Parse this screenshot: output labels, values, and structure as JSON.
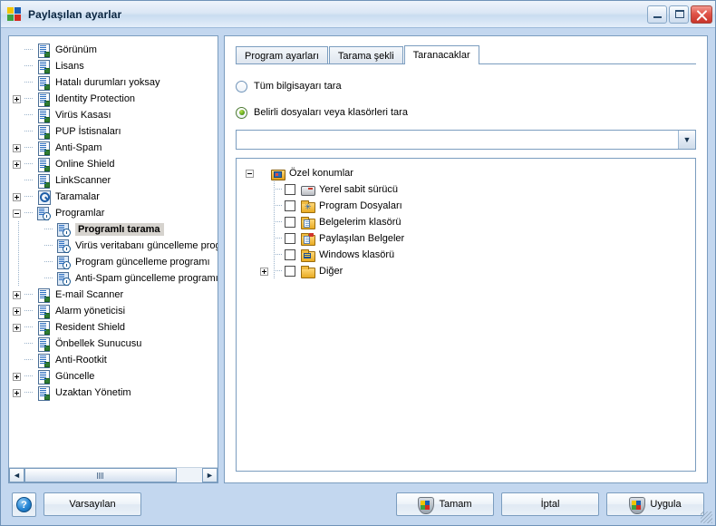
{
  "window": {
    "title": "Paylaşılan ayarlar",
    "icon": "avg-logo-icon",
    "minimize_label": "",
    "maximize_label": "",
    "close_label": ""
  },
  "sidebar": {
    "items": [
      {
        "label": "Görünüm",
        "icon": "settings-doc-icon",
        "expander": "none",
        "depth": 1,
        "selected": false
      },
      {
        "label": "Lisans",
        "icon": "settings-doc-icon",
        "expander": "none",
        "depth": 1,
        "selected": false
      },
      {
        "label": "Hatalı durumları yoksay",
        "icon": "settings-doc-icon",
        "expander": "none",
        "depth": 1,
        "selected": false
      },
      {
        "label": "Identity Protection",
        "icon": "settings-doc-icon",
        "expander": "plus",
        "depth": 1,
        "selected": false
      },
      {
        "label": "Virüs Kasası",
        "icon": "settings-doc-icon",
        "expander": "none",
        "depth": 1,
        "selected": false
      },
      {
        "label": "PUP İstisnaları",
        "icon": "settings-doc-icon",
        "expander": "none",
        "depth": 1,
        "selected": false
      },
      {
        "label": "Anti-Spam",
        "icon": "settings-doc-icon",
        "expander": "plus",
        "depth": 1,
        "selected": false
      },
      {
        "label": "Online Shield",
        "icon": "settings-doc-icon",
        "expander": "plus",
        "depth": 1,
        "selected": false
      },
      {
        "label": "LinkScanner",
        "icon": "settings-doc-icon",
        "expander": "none",
        "depth": 1,
        "selected": false
      },
      {
        "label": "Taramalar",
        "icon": "scan-magnifier-icon",
        "expander": "plus",
        "depth": 1,
        "selected": false
      },
      {
        "label": "Programlar",
        "icon": "schedule-clock-icon",
        "expander": "minus",
        "depth": 1,
        "selected": false
      },
      {
        "label": "Programlı tarama",
        "icon": "schedule-clock-icon",
        "expander": "none",
        "depth": 2,
        "selected": true
      },
      {
        "label": "Virüs veritabanı güncelleme programı",
        "icon": "schedule-clock-icon",
        "expander": "none",
        "depth": 2,
        "selected": false
      },
      {
        "label": "Program güncelleme programı",
        "icon": "schedule-clock-icon",
        "expander": "none",
        "depth": 2,
        "selected": false
      },
      {
        "label": "Anti-Spam güncelleme programı",
        "icon": "schedule-clock-icon",
        "expander": "none",
        "depth": 2,
        "selected": false
      },
      {
        "label": "E-mail Scanner",
        "icon": "settings-doc-icon",
        "expander": "plus",
        "depth": 1,
        "selected": false
      },
      {
        "label": "Alarm yöneticisi",
        "icon": "settings-doc-icon",
        "expander": "plus",
        "depth": 1,
        "selected": false
      },
      {
        "label": "Resident Shield",
        "icon": "settings-doc-icon",
        "expander": "plus",
        "depth": 1,
        "selected": false
      },
      {
        "label": "Önbellek Sunucusu",
        "icon": "settings-doc-icon",
        "expander": "none",
        "depth": 1,
        "selected": false
      },
      {
        "label": "Anti-Rootkit",
        "icon": "settings-doc-icon",
        "expander": "none",
        "depth": 1,
        "selected": false
      },
      {
        "label": "Güncelle",
        "icon": "settings-doc-icon",
        "expander": "plus",
        "depth": 1,
        "selected": false
      },
      {
        "label": "Uzaktan Yönetim",
        "icon": "settings-doc-icon",
        "expander": "plus",
        "depth": 1,
        "selected": false
      }
    ],
    "scroll_left_label": "◄",
    "scroll_right_label": "►"
  },
  "main": {
    "tabs": [
      {
        "label": "Program ayarları",
        "active": false
      },
      {
        "label": "Tarama şekli",
        "active": false
      },
      {
        "label": "Taranacaklar",
        "active": true
      }
    ],
    "radios": [
      {
        "label": "Tüm bilgisayarı tara",
        "checked": false
      },
      {
        "label": "Belirli dosyaları veya klasörleri tara",
        "checked": true
      }
    ],
    "combo": {
      "value": "",
      "arrow": "▼"
    },
    "filetree": [
      {
        "label": "Özel konumlar",
        "icon": "special-locations-folder-icon",
        "expander": "minus",
        "checkbox": false,
        "has_checkbox": false,
        "depth": 0
      },
      {
        "label": "Yerel sabit sürücü",
        "icon": "hard-drive-icon",
        "expander": "none",
        "checkbox": false,
        "has_checkbox": true,
        "depth": 1
      },
      {
        "label": "Program Dosyaları",
        "icon": "program-files-folder-icon",
        "expander": "none",
        "checkbox": false,
        "has_checkbox": true,
        "depth": 1
      },
      {
        "label": "Belgelerim klasörü",
        "icon": "my-documents-folder-icon",
        "expander": "none",
        "checkbox": false,
        "has_checkbox": true,
        "depth": 1
      },
      {
        "label": "Paylaşılan Belgeler",
        "icon": "shared-documents-folder-icon",
        "expander": "none",
        "checkbox": false,
        "has_checkbox": true,
        "depth": 1
      },
      {
        "label": "Windows klasörü",
        "icon": "windows-folder-icon",
        "expander": "none",
        "checkbox": false,
        "has_checkbox": true,
        "depth": 1
      },
      {
        "label": "Diğer",
        "icon": "other-folder-icon",
        "expander": "plus",
        "checkbox": false,
        "has_checkbox": true,
        "depth": 1
      }
    ]
  },
  "footer": {
    "help_label": "?",
    "defaults_label": "Varsayılan",
    "ok_label": "Tamam",
    "cancel_label": "İptal",
    "apply_label": "Uygula"
  },
  "colors": {
    "frame": "#c3d7ef",
    "border": "#7b9dbf",
    "selection": "#d6d3ce",
    "radio_green": "#5fa51e"
  }
}
